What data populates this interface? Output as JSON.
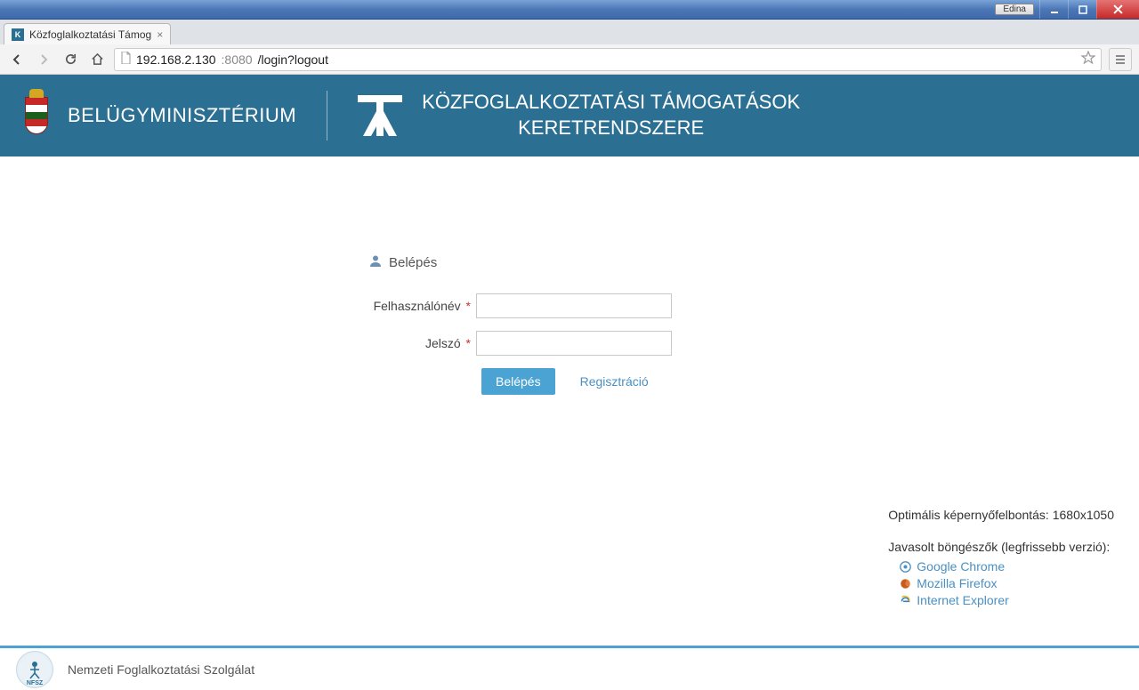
{
  "os": {
    "user_badge": "Edina"
  },
  "browser": {
    "tab_title": "Közfoglalkoztatási Támog",
    "url_host": "192.168.2.130",
    "url_port": ":8080",
    "url_path": "/login?logout"
  },
  "header": {
    "ministry": "BELÜGYMINISZTÉRIUM",
    "app_title_line1": "KÖZFOGLALKOZTATÁSI TÁMOGATÁSOK",
    "app_title_line2": "KERETRENDSZERE"
  },
  "login": {
    "heading": "Belépés",
    "username_label": "Felhasználónév",
    "password_label": "Jelszó",
    "username_value": "",
    "password_value": "",
    "submit_label": "Belépés",
    "register_label": "Regisztráció"
  },
  "sideinfo": {
    "resolution_label": "Optimális képernyőfelbontás: 1680x1050",
    "browsers_label": "Javasolt böngészők (legfrissebb verzió):",
    "browsers": {
      "chrome": "Google Chrome",
      "firefox": "Mozilla Firefox",
      "ie": "Internet Explorer"
    }
  },
  "footer": {
    "org": "Nemzeti Foglalkoztatási Szolgálat",
    "logo_caption": "NFSZ"
  }
}
